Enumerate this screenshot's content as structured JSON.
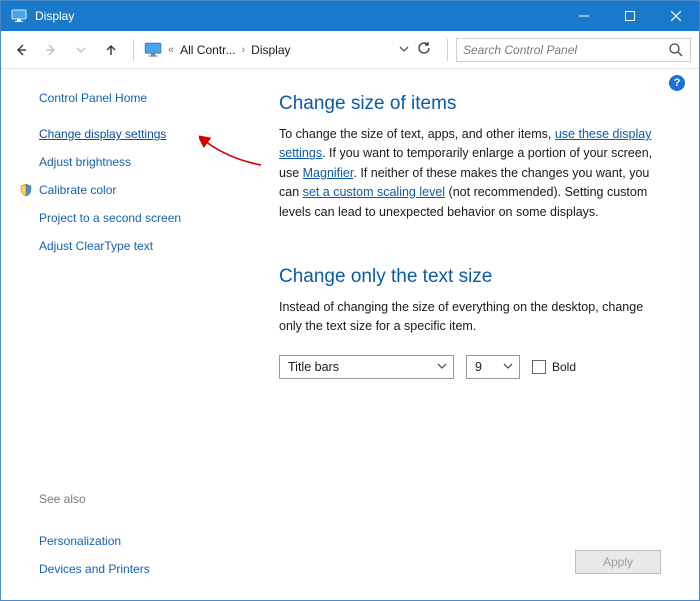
{
  "window": {
    "title": "Display"
  },
  "addressbar": {
    "crumb1": "All Contr...",
    "crumb2": "Display"
  },
  "search": {
    "placeholder": "Search Control Panel"
  },
  "help": {
    "glyph": "?"
  },
  "sidebar": {
    "home": "Control Panel Home",
    "links": {
      "change_display": "Change display settings",
      "adjust_brightness": "Adjust brightness",
      "calibrate_color": "Calibrate color",
      "project": "Project to a second screen",
      "cleartype": "Adjust ClearType text"
    },
    "see_also_head": "See also",
    "see_also": {
      "personalization": "Personalization",
      "devices": "Devices and Printers"
    }
  },
  "main": {
    "h1": "Change size of items",
    "p1_a": "To change the size of text, apps, and other items, ",
    "p1_link1": "use these display settings",
    "p1_b": ".  If you want to temporarily enlarge a portion of your screen, use ",
    "p1_link2": "Magnifier",
    "p1_c": ".  If neither of these makes the changes you want, you can ",
    "p1_link3": "set a custom scaling level",
    "p1_d": " (not recommended).  Setting custom levels can lead to unexpected behavior on some displays.",
    "h2": "Change only the text size",
    "p2": "Instead of changing the size of everything on the desktop, change only the text size for a specific item.",
    "combo_item": "Title bars",
    "combo_size": "9",
    "bold_label": "Bold",
    "apply": "Apply"
  }
}
